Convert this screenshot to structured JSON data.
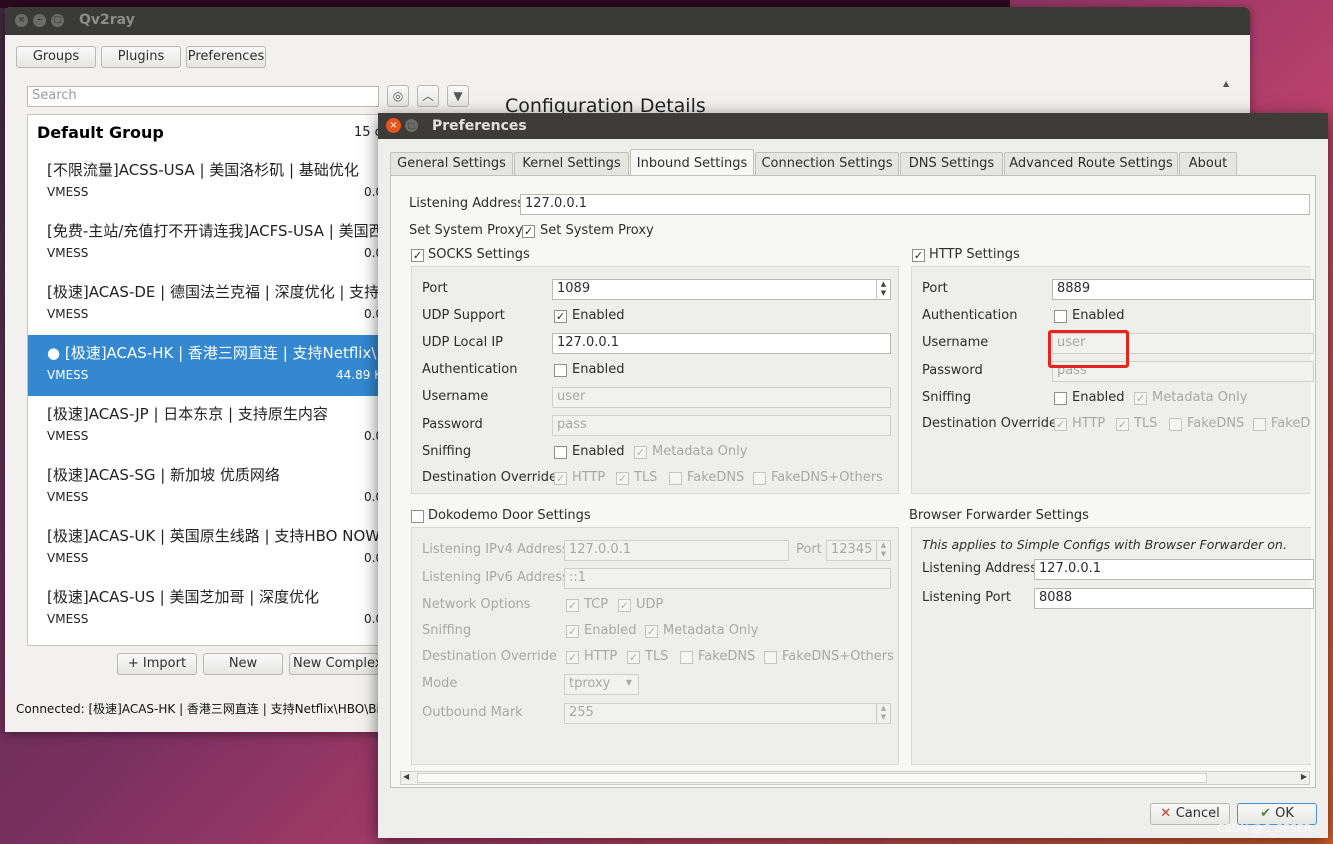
{
  "main": {
    "title": "Qv2ray",
    "toolbar": [
      "Groups",
      "Plugins",
      "Preferences"
    ],
    "search_placeholder": "Search",
    "config_title": "Configuration Details",
    "group_name": "Default Group",
    "group_count": "15 c",
    "connections": [
      {
        "name": "[不限流量]ACSS-USA | 美国洛杉矶 | 基础优化",
        "type": "VMESS",
        "stat": "0.0"
      },
      {
        "name": "[免费-主站/充值打不开请连我]ACFS-USA | 美国西",
        "type": "VMESS",
        "stat": "0.0"
      },
      {
        "name": "[极速]ACAS-DE | 德国法兰克福 | 深度优化 | 支持",
        "type": "VMESS",
        "stat": "0.0"
      },
      {
        "name": "● [极速]ACAS-HK | 香港三网直连 | 支持Netflix\\",
        "type": "VMESS",
        "stat": "44.89 K"
      },
      {
        "name": "[极速]ACAS-JP | 日本东京 | 支持原生内容",
        "type": "VMESS",
        "stat": "0.0"
      },
      {
        "name": "[极速]ACAS-SG | 新加坡 优质网络",
        "type": "VMESS",
        "stat": "0.0"
      },
      {
        "name": "[极速]ACAS-UK | 英国原生线路 | 支持HBO NOW",
        "type": "VMESS",
        "stat": "0.0"
      },
      {
        "name": "[极速]ACAS-US | 美国芝加哥 | 深度优化",
        "type": "VMESS",
        "stat": "0.0"
      }
    ],
    "bottom_buttons": {
      "import": "+ Import",
      "new": "New",
      "new_complex": "New Complex"
    },
    "status": "Connected: [极速]ACAS-HK | 香港三网直连 | 支持Netflix\\HBO\\Bi"
  },
  "prefs": {
    "title": "Preferences",
    "tabs": [
      "General Settings",
      "Kernel Settings",
      "Inbound Settings",
      "Connection Settings",
      "DNS Settings",
      "Advanced Route Settings",
      "About"
    ],
    "active_tab": "Inbound Settings",
    "listening_address_label": "Listening Address",
    "listening_address": "127.0.0.1",
    "system_proxy_label": "Set System Proxy",
    "system_proxy_check": "Set System Proxy",
    "socks": {
      "title": "SOCKS Settings",
      "port_label": "Port",
      "port": "1089",
      "udp_support_label": "UDP Support",
      "udp_enabled": "Enabled",
      "udp_local_ip_label": "UDP Local IP",
      "udp_local_ip": "127.0.0.1",
      "auth_label": "Authentication",
      "auth_enabled": "Enabled",
      "username_label": "Username",
      "username": "user",
      "password_label": "Password",
      "password": "pass",
      "sniffing_label": "Sniffing",
      "sniff_enabled": "Enabled",
      "metadata_only": "Metadata Only",
      "dest_override_label": "Destination Override",
      "overrides": [
        "HTTP",
        "TLS",
        "FakeDNS",
        "FakeDNS+Others"
      ]
    },
    "http": {
      "title": "HTTP Settings",
      "port_label": "Port",
      "port": "8889",
      "auth_label": "Authentication",
      "auth_enabled": "Enabled",
      "username_label": "Username",
      "username": "user",
      "password_label": "Password",
      "password": "pass",
      "sniffing_label": "Sniffing",
      "sniff_enabled": "Enabled",
      "metadata_only": "Metadata Only",
      "dest_override_label": "Destination Override",
      "overrides": [
        "HTTP",
        "TLS",
        "FakeDNS",
        "FakeD"
      ]
    },
    "dokodemo": {
      "title": "Dokodemo Door Settings",
      "ipv4_label": "Listening IPv4 Address",
      "ipv4": "127.0.0.1",
      "port_label": "Port",
      "port": "12345",
      "ipv6_label": "Listening IPv6 Address",
      "ipv6": "::1",
      "network_label": "Network Options",
      "tcp": "TCP",
      "udp": "UDP",
      "sniffing_label": "Sniffing",
      "sniff_enabled": "Enabled",
      "metadata_only": "Metadata Only",
      "dest_override_label": "Destination Override",
      "overrides": [
        "HTTP",
        "TLS",
        "FakeDNS",
        "FakeDNS+Others"
      ],
      "mode_label": "Mode",
      "mode": "tproxy",
      "outbound_mark_label": "Outbound Mark",
      "outbound_mark": "255"
    },
    "browser": {
      "title": "Browser Forwarder Settings",
      "note": "This applies to Simple Configs with Browser Forwarder on.",
      "address_label": "Listening Address",
      "address": "127.0.0.1",
      "port_label": "Listening Port",
      "port": "8088"
    },
    "cancel": "Cancel",
    "ok": "OK"
  },
  "watermark": "CSDN @C_SESER"
}
